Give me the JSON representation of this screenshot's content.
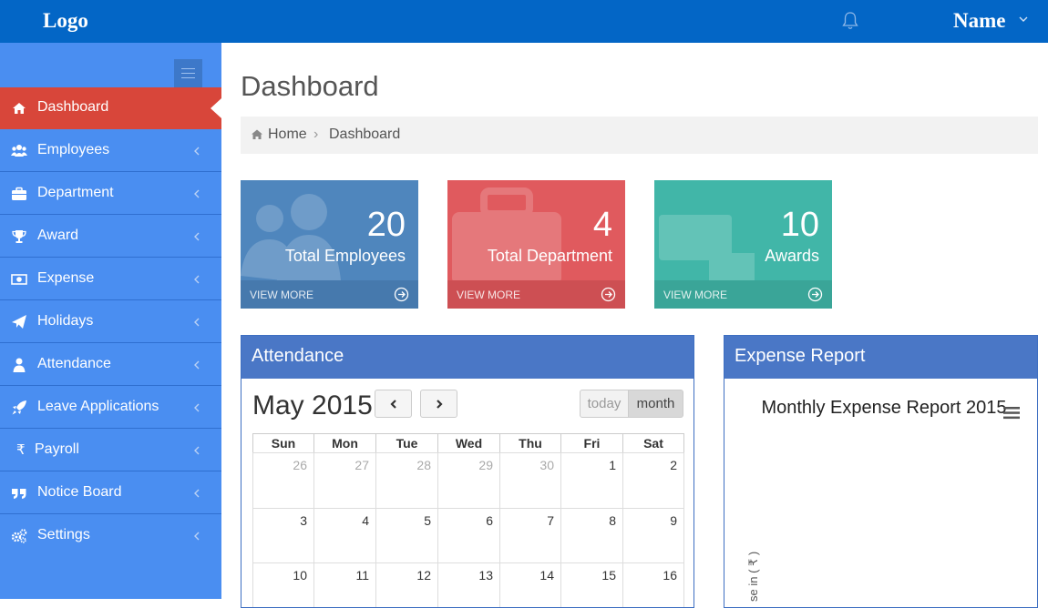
{
  "header": {
    "logo": "Logo",
    "user_name": "Name",
    "icons": [
      "bell-icon",
      "chevron-down-icon"
    ]
  },
  "sidebar": {
    "toggle_icon": "menu-icon",
    "items": [
      {
        "label": "Dashboard",
        "icon": "home-icon",
        "active": true
      },
      {
        "label": "Employees",
        "icon": "users-icon"
      },
      {
        "label": "Department",
        "icon": "briefcase-icon"
      },
      {
        "label": "Award",
        "icon": "trophy-icon"
      },
      {
        "label": "Expense",
        "icon": "money-icon"
      },
      {
        "label": "Holidays",
        "icon": "paper-plane-icon"
      },
      {
        "label": "Attendance",
        "icon": "user-icon"
      },
      {
        "label": "Leave Applications",
        "icon": "rocket-icon"
      },
      {
        "label": "Payroll",
        "icon": "rupee-icon"
      },
      {
        "label": "Notice Board",
        "icon": "quote-icon"
      },
      {
        "label": "Settings",
        "icon": "cogs-icon"
      }
    ],
    "payroll_glyph": "₹"
  },
  "main": {
    "title": "Dashboard",
    "breadcrumb": {
      "home": "Home",
      "separator": "›",
      "current": "Dashboard"
    },
    "stats": [
      {
        "value": "20",
        "label": "Total Employees",
        "more": "VIEW MORE",
        "color": "#4f86bd",
        "footer_color": "#4679ad",
        "icon": "users-icon"
      },
      {
        "value": "4",
        "label": "Total Department",
        "more": "VIEW MORE",
        "color": "#e05a5e",
        "footer_color": "#cd4f53",
        "icon": "briefcase-icon"
      },
      {
        "value": "10",
        "label": "Awards",
        "more": "VIEW MORE",
        "color": "#41b6a8",
        "footer_color": "#3aa598",
        "icon": "desktop-icon"
      }
    ]
  },
  "attendance": {
    "title": "Attendance",
    "month_title": "May 2015",
    "prev_icon": "chevron-left-icon",
    "next_icon": "chevron-right-icon",
    "today_label": "today",
    "month_label": "month",
    "weekdays": [
      "Sun",
      "Mon",
      "Tue",
      "Wed",
      "Thu",
      "Fri",
      "Sat"
    ],
    "weeks": [
      [
        {
          "d": "26",
          "o": true
        },
        {
          "d": "27",
          "o": true
        },
        {
          "d": "28",
          "o": true
        },
        {
          "d": "29",
          "o": true
        },
        {
          "d": "30",
          "o": true
        },
        {
          "d": "1"
        },
        {
          "d": "2"
        }
      ],
      [
        {
          "d": "3"
        },
        {
          "d": "4"
        },
        {
          "d": "5"
        },
        {
          "d": "6"
        },
        {
          "d": "7"
        },
        {
          "d": "8"
        },
        {
          "d": "9"
        }
      ],
      [
        {
          "d": "10"
        },
        {
          "d": "11"
        },
        {
          "d": "12"
        },
        {
          "d": "13"
        },
        {
          "d": "14"
        },
        {
          "d": "15"
        },
        {
          "d": "16"
        }
      ]
    ]
  },
  "expense": {
    "title": "Expense Report",
    "chart_title": "Monthly Expense Report 2015",
    "ylabel_visible": "se in ( ₹ )",
    "menu_icon": "hamburger-icon"
  }
}
